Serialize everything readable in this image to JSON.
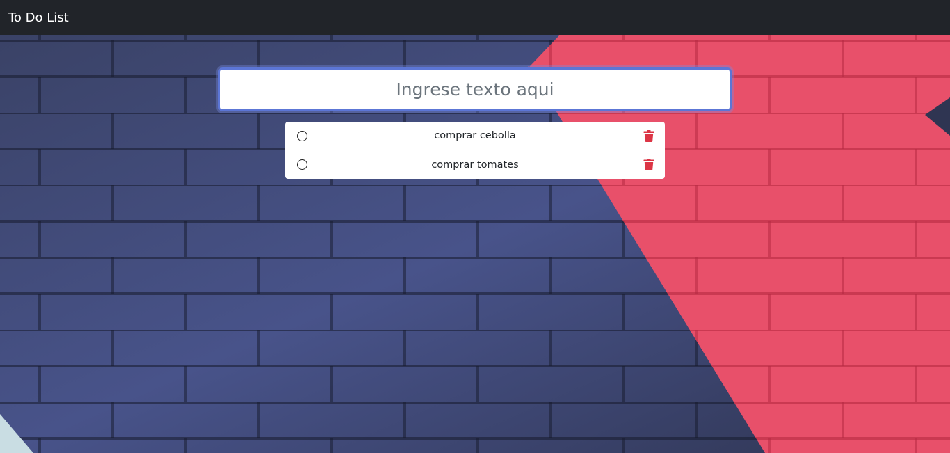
{
  "app": {
    "title": "To Do List"
  },
  "input": {
    "placeholder": "Ingrese texto aqui",
    "value": ""
  },
  "todos": [
    {
      "text": "comprar cebolla",
      "done": false
    },
    {
      "text": "comprar tomates",
      "done": false
    }
  ],
  "icons": {
    "check": "circle-outline-icon",
    "delete": "trash-icon"
  },
  "colors": {
    "navbar": "#212429",
    "delete": "#dc3545",
    "input_focus": "#5c76d6",
    "wall_blue": "#3d4568",
    "wall_red": "#e84a62"
  }
}
